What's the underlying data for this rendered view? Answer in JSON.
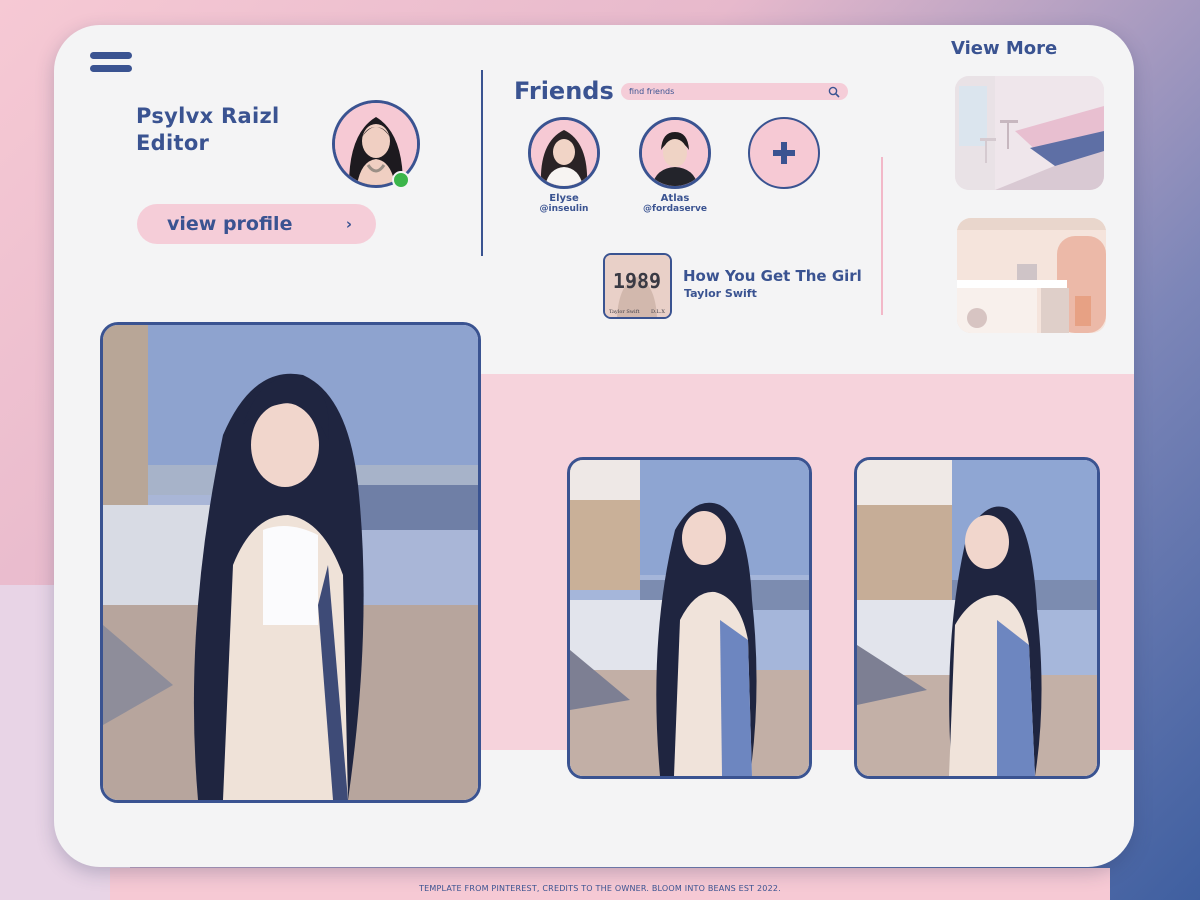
{
  "profile": {
    "name": "Psylvx Raizl",
    "role": "Editor",
    "status": "online",
    "view_profile_label": "view profile",
    "view_profile_chevron": "›"
  },
  "friends": {
    "title": "Friends",
    "search_placeholder": "find friends",
    "items": [
      {
        "name": "Elyse",
        "handle": "@inseulin"
      },
      {
        "name": "Atlas",
        "handle": "@fordaserve"
      }
    ]
  },
  "now_playing": {
    "title": "How You Get The Girl",
    "artist": "Taylor Swift",
    "album_text": "1989",
    "album_caption_left": "Taylor Swift",
    "album_caption_right": "D.L.X"
  },
  "gallery": {
    "view_more_label": "View More"
  },
  "footer": {
    "credit": "TEMPLATE FROM PINTEREST, CREDITS TO THE OWNER. BLOOM INTO BEANS EST 2022."
  },
  "theme": {
    "navy": "#3a5391",
    "pink": "#f6c9d4",
    "background": "#f4f4f5",
    "status_online": "#3bb54a"
  },
  "icons": [
    "menu-icon",
    "search-icon",
    "plus-icon",
    "chevron-right-icon"
  ]
}
